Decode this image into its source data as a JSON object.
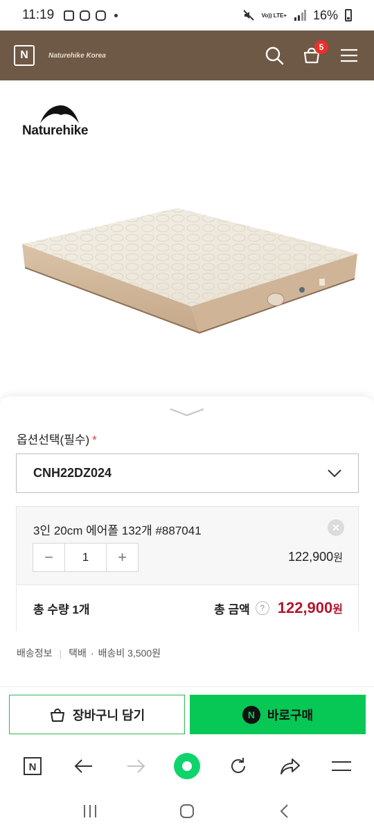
{
  "status_bar": {
    "time": "11:19",
    "network_top": "Vo)) LTE+",
    "battery_percent": "16%"
  },
  "header": {
    "logo_letter": "N",
    "brand_text": "Naturehike Korea",
    "cart_count": "5",
    "background_color": "#6e5846"
  },
  "product": {
    "brand_logo_text": "Naturehike"
  },
  "options": {
    "label": "옵션선택(필수)",
    "required_mark": "*",
    "selected_value": "CNH22DZ024"
  },
  "selected_item": {
    "name": "3인 20cm 에어폴 132개 #887041",
    "quantity": "1",
    "minus": "−",
    "plus": "+",
    "price": "122,900",
    "currency": "원"
  },
  "totals": {
    "quantity_text": "총 수량 1개",
    "amount_label": "총 금액",
    "help_mark": "?",
    "amount": "122,900",
    "currency": "원",
    "amount_color": "#b3152e"
  },
  "shipping": {
    "label": "배송정보",
    "method": "택배",
    "fee": "배송비 3,500원"
  },
  "actions": {
    "cart_label": "장바구니 담기",
    "buy_label": "바로구매",
    "buy_icon_letter": "N",
    "buy_color": "#07c755"
  },
  "browser_toolbar": {
    "tab_letter": "N",
    "icons": [
      "tabs-icon",
      "back-icon",
      "forward-icon",
      "home-icon",
      "refresh-icon",
      "share-icon",
      "menu-icon"
    ]
  },
  "nav_bar": {
    "icons": [
      "recents-icon",
      "home-button-icon",
      "back-nav-icon"
    ]
  }
}
